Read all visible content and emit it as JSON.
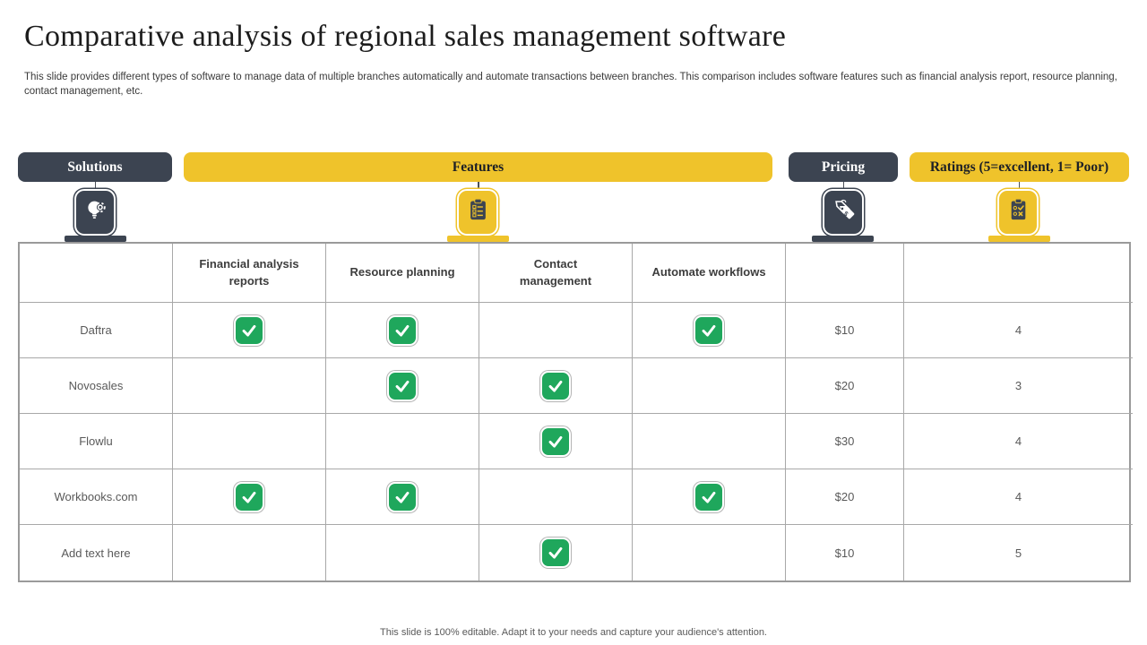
{
  "slide": {
    "title": "Comparative analysis of regional sales management software",
    "description": "This slide provides different types of software to manage data of multiple branches automatically and automate transactions between branches. This comparison includes software features such as financial analysis report, resource planning, contact management, etc.",
    "footer": "This slide is 100% editable.  Adapt it to your needs and capture your audience's attention."
  },
  "colors": {
    "dark": "#3C4451",
    "yellow": "#EFC32B",
    "green": "#1FA75C"
  },
  "header_pills": {
    "solutions": {
      "label": "Solutions",
      "icon": "lightbulb-gear-icon"
    },
    "features": {
      "label": "Features",
      "icon": "checklist-clipboard-icon"
    },
    "pricing": {
      "label": "Pricing",
      "icon": "price-tags-icon"
    },
    "ratings": {
      "label": "Ratings (5=excellent, 1= Poor)",
      "icon": "rating-clipboard-icon"
    }
  },
  "table": {
    "feature_headers": [
      "Financial analysis reports",
      "Resource planning",
      "Contact management",
      "Automate workflows"
    ],
    "rows": [
      {
        "name": "Daftra",
        "features": [
          true,
          true,
          false,
          true
        ],
        "pricing": "$10",
        "rating": "4"
      },
      {
        "name": "Novosales",
        "features": [
          false,
          true,
          true,
          false
        ],
        "pricing": "$20",
        "rating": "3"
      },
      {
        "name": "Flowlu",
        "features": [
          false,
          false,
          true,
          false
        ],
        "pricing": "$30",
        "rating": "4"
      },
      {
        "name": "Workbooks.com",
        "features": [
          true,
          true,
          false,
          true
        ],
        "pricing": "$20",
        "rating": "4"
      },
      {
        "name": "Add text here",
        "features": [
          false,
          false,
          true,
          false
        ],
        "pricing": "$10",
        "rating": "5"
      }
    ]
  }
}
